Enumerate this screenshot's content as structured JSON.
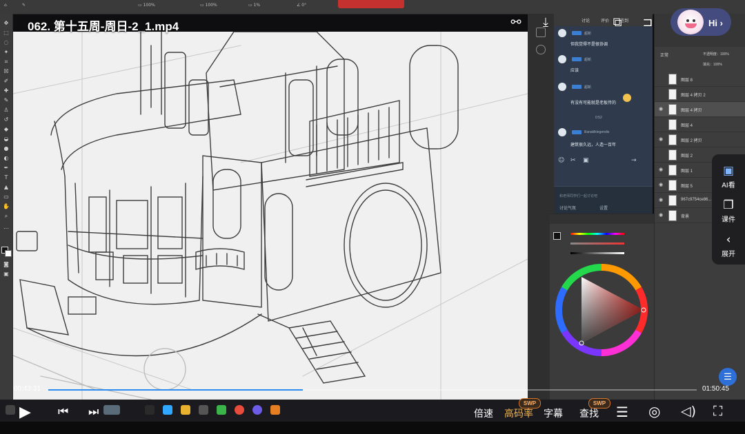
{
  "video": {
    "title": "062. 第十五周-周日-2_1.mp4",
    "time_current": "00:43:31",
    "time_total": "01:50:45",
    "progress_fraction": 0.393
  },
  "controls": {
    "speed_label": "倍速",
    "quality_label": "高码率",
    "subtitle_label": "字幕",
    "search_label": "查找",
    "swp_badge": "SWP"
  },
  "assistant": {
    "greeting": "Hi",
    "side_items": [
      {
        "label": "AI看",
        "icon": "ai-watch-icon"
      },
      {
        "label": "课件",
        "icon": "courseware-icon"
      },
      {
        "label": "展开",
        "icon": "chevron-left-icon"
      }
    ]
  },
  "chat": {
    "tabs": [
      "讨论",
      "评价",
      "签到"
    ],
    "messages": [
      {
        "name": "超新",
        "text": "但我觉得不是很协调"
      },
      {
        "name": "超新",
        "text": "应该"
      },
      {
        "name": "超新",
        "text": "有没有可能就是老板传的"
      },
      {
        "time": "0:52"
      },
      {
        "name": "lilanaklklegendis",
        "text": "建筑很久远，人造一百年"
      }
    ],
    "input_placeholder": "和老师同学们一起讨论吧",
    "footer_left": "讨论气氛",
    "footer_right": "设置"
  },
  "layers_panel": {
    "mode": "正常",
    "opacity_label": "不透明度：100%",
    "fill_label": "填充：100%",
    "layers": [
      {
        "name": "图层 8",
        "visible": false,
        "selected": false
      },
      {
        "name": "图层 4 拷贝 2",
        "visible": false,
        "selected": false
      },
      {
        "name": "图层 4 拷贝",
        "visible": true,
        "selected": true
      },
      {
        "name": "图层 4",
        "visible": false,
        "selected": false
      },
      {
        "name": "图层 2 拷贝",
        "visible": true,
        "selected": false
      },
      {
        "name": "图层 2",
        "visible": false,
        "selected": false
      },
      {
        "name": "图层 1",
        "visible": true,
        "selected": false
      },
      {
        "name": "图层 5",
        "visible": true,
        "selected": false
      },
      {
        "name": "967c9754ce86...",
        "visible": true,
        "selected": false
      },
      {
        "name": "背景",
        "visible": true,
        "selected": false
      }
    ]
  },
  "colors": {
    "accent": "#2d8cf0",
    "swp_orange": "#d9752a"
  }
}
